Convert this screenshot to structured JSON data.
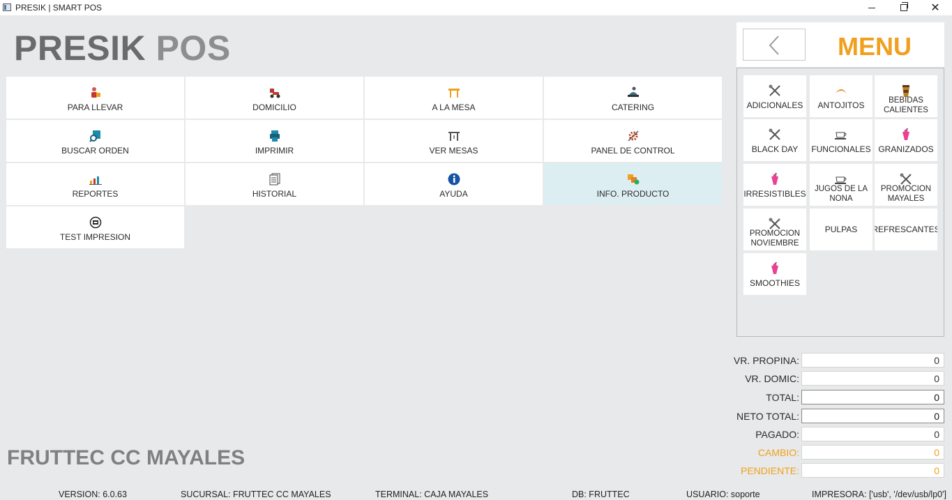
{
  "window": {
    "title": "PRESIK  |  SMART POS",
    "minimize_glyph": "",
    "close_glyph": "✕"
  },
  "brand": {
    "part1": "PRESIK",
    "part2": "POS"
  },
  "actions": [
    {
      "label": "PARA LLEVAR",
      "icon": "takeaway-icon"
    },
    {
      "label": "DOMICILIO",
      "icon": "delivery-icon"
    },
    {
      "label": "A LA MESA",
      "icon": "table-icon"
    },
    {
      "label": "CATERING",
      "icon": "catering-icon"
    },
    {
      "label": "BUSCAR ORDEN",
      "icon": "search-order-icon"
    },
    {
      "label": "IMPRIMIR",
      "icon": "printer-icon"
    },
    {
      "label": "VER MESAS",
      "icon": "tables-icon"
    },
    {
      "label": "PANEL DE CONTROL",
      "icon": "control-panel-icon"
    },
    {
      "label": "REPORTES",
      "icon": "reports-icon"
    },
    {
      "label": "HISTORIAL",
      "icon": "history-icon"
    },
    {
      "label": "AYUDA",
      "icon": "info-icon"
    },
    {
      "label": "INFO. PRODUCTO",
      "icon": "product-info-icon",
      "active": true
    },
    {
      "label": "TEST IMPRESION",
      "icon": "print-test-icon"
    }
  ],
  "menu": {
    "title": "MENU",
    "back_icon": "chevron-left-icon",
    "categories": [
      {
        "label": "ADICIONALES",
        "icon": "utensils-icon"
      },
      {
        "label": "ANTOJITOS",
        "icon": "croissant-icon"
      },
      {
        "label": "BEBIDAS CALIENTES",
        "icon": "coffee-cup-icon"
      },
      {
        "label": "BLACK DAY",
        "icon": "utensils-icon"
      },
      {
        "label": "FUNCIONALES",
        "icon": "teacup-icon"
      },
      {
        "label": "GRANIZADOS",
        "icon": "smoothie-icon"
      },
      {
        "label": "IRRESISTIBLES",
        "icon": "smoothie-icon"
      },
      {
        "label": "JUGOS DE LA NONA",
        "icon": "teacup-icon"
      },
      {
        "label": "PROMOCION MAYALES",
        "icon": "utensils-icon"
      },
      {
        "label": "PROMOCION NOVIEMBRE",
        "icon": "utensils-icon"
      },
      {
        "label": "PULPAS",
        "icon": ""
      },
      {
        "label": "REFRESCANTES",
        "icon": ""
      },
      {
        "label": "SMOOTHIES",
        "icon": "smoothie-icon"
      }
    ]
  },
  "totals": [
    {
      "label": "VR. PROPINA:",
      "value": "0"
    },
    {
      "label": "VR. DOMIC:",
      "value": "0"
    },
    {
      "label": "TOTAL:",
      "value": "0"
    },
    {
      "label": "NETO TOTAL:",
      "value": "0"
    },
    {
      "label": "PAGADO:",
      "value": "0"
    },
    {
      "label": "CAMBIO:",
      "value": "0"
    },
    {
      "label": "PENDIENTE:",
      "value": "0"
    }
  ],
  "store_name": "FRUTTEC CC MAYALES",
  "status_bar": {
    "version": "VERSION:  6.0.63",
    "branch": "SUCURSAL:  FRUTTEC CC MAYALES",
    "terminal": "TERMINAL:  CAJA MAYALES",
    "db": "DB:  FRUTTEC",
    "user": "USUARIO:  soporte",
    "printer": "IMPRESORA:  ['usb', '/dev/usb/lp0']"
  },
  "colors": {
    "accent": "#f0a01e",
    "active_tile": "#ddeef3",
    "brand_gray": "#6b6b6b"
  }
}
